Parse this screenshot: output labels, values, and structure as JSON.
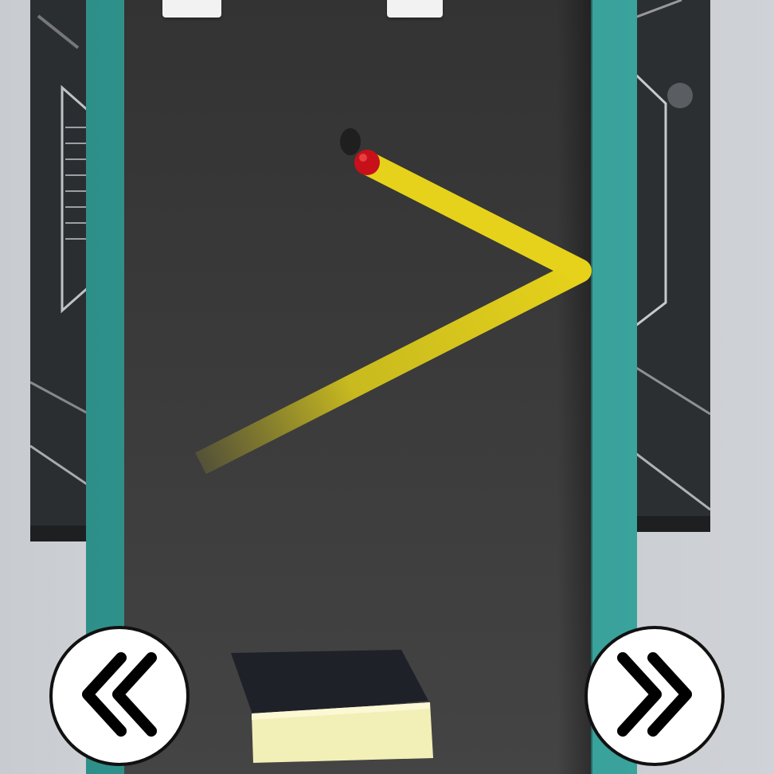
{
  "game": {
    "controls": {
      "left": {
        "icon": "double-chevron-left-icon"
      },
      "right": {
        "icon": "double-chevron-right-icon"
      }
    },
    "colors": {
      "board_frame": "#3aa39c",
      "board_surface": "#3b3b3b",
      "trajectory": "#e6d21a",
      "ball": "#c8101a",
      "paddle_top": "#f2efb7",
      "paddle_back": "#1e2128",
      "wall": "#c9ccd1"
    }
  }
}
